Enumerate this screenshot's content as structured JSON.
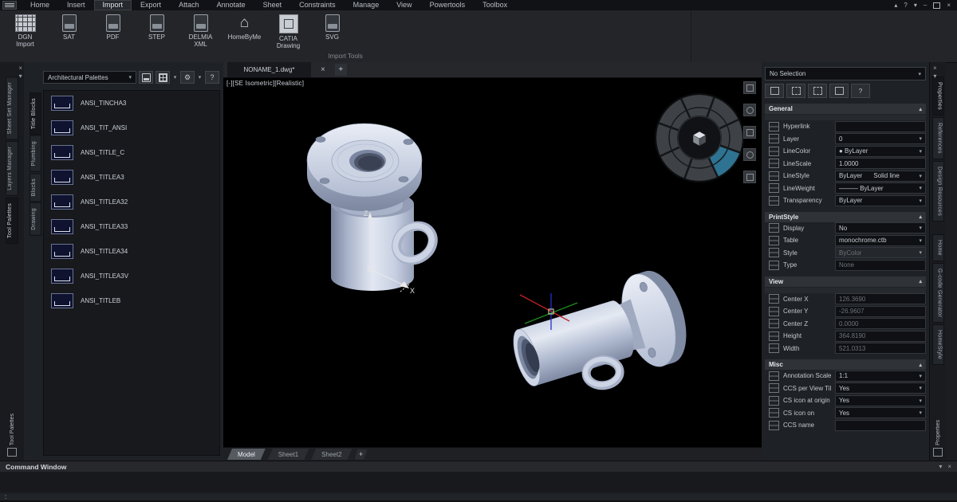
{
  "glyphs": {
    "dropdown": "▾",
    "collapse": "▴",
    "expand": "▴",
    "close": "×",
    "minimize": "–",
    "help": "?",
    "house": "⌂",
    "gear": "⚙",
    "prompt": ":"
  },
  "menubar": {
    "items": [
      "Home",
      "Insert",
      "Import",
      "Export",
      "Attach",
      "Annotate",
      "Sheet",
      "Constraints",
      "Manage",
      "View",
      "Powertools",
      "Toolbox"
    ],
    "active": "Import"
  },
  "ribbon": {
    "group_label": "Import Tools",
    "tools": [
      {
        "label": "DGN\nImport"
      },
      {
        "label": "SAT"
      },
      {
        "label": "PDF"
      },
      {
        "label": "STEP"
      },
      {
        "label": "DELMIA\nXML"
      },
      {
        "label": "HomeByMe"
      },
      {
        "label": "CATIA\nDrawing"
      },
      {
        "label": "SVG"
      }
    ]
  },
  "left_rail": {
    "tabs": [
      "Sheet Set Manager",
      "Layers Manager",
      "Tool Palettes"
    ],
    "active": "Tool Palettes",
    "bottom_label": "Tool Palettes"
  },
  "right_rail": {
    "tabs": [
      "Properties",
      "References",
      "Design Resources",
      "Home",
      "G-code Generator",
      "HomeStyle"
    ],
    "active": "Properties",
    "bottom_label": "Properties"
  },
  "palette": {
    "dropdown": "Architectural Palettes",
    "tabs": [
      "Title Blocks",
      "Plumbing",
      "Blocks",
      "Drawing"
    ],
    "items": [
      "ANSI_TINCHA3",
      "ANSI_TIT_ANSI",
      "ANSI_TITLE_C",
      "ANSI_TITLEA3",
      "ANSI_TITLEA32",
      "ANSI_TITLEA33",
      "ANSI_TITLEA34",
      "ANSI_TITLEA3V",
      "ANSI_TITLEB"
    ]
  },
  "document": {
    "tab": "NONAME_1.dwg*",
    "new_tab": "+"
  },
  "viewport": {
    "view_control": "[-][SE Isometric][Realistic]",
    "ucs_z": "Z",
    "ucs_x": "X"
  },
  "sheet_tabs": {
    "items": [
      "Model",
      "Sheet1",
      "Sheet2"
    ],
    "active": "Model",
    "add": "+"
  },
  "properties": {
    "selector": "No Selection",
    "sections": [
      {
        "title": "General",
        "rows": [
          {
            "label": "Hyperlink",
            "value": ""
          },
          {
            "label": "Layer",
            "value": "0"
          },
          {
            "label": "LineColor",
            "value": "● ByLayer"
          },
          {
            "label": "LineScale",
            "value": "1.0000"
          },
          {
            "label": "LineStyle",
            "value": "ByLayer",
            "value2": "Solid line"
          },
          {
            "label": "LineWeight",
            "value": "——— ByLayer"
          },
          {
            "label": "Transparency",
            "value": "ByLayer"
          }
        ]
      },
      {
        "title": "PrintStyle",
        "rows": [
          {
            "label": "Display",
            "value": "No"
          },
          {
            "label": "Table",
            "value": "monochrome.ctb"
          },
          {
            "label": "Style",
            "value": "ByColor"
          },
          {
            "label": "Type",
            "value": "None"
          }
        ]
      },
      {
        "title": "View",
        "rows": [
          {
            "label": "Center X",
            "value": "126.3690"
          },
          {
            "label": "Center Y",
            "value": "-26.9607"
          },
          {
            "label": "Center Z",
            "value": "0.0000"
          },
          {
            "label": "Height",
            "value": "364.8190"
          },
          {
            "label": "Width",
            "value": "521.0313"
          }
        ]
      },
      {
        "title": "Misc",
        "rows": [
          {
            "label": "Annotation Scale",
            "value": "1:1"
          },
          {
            "label": "CCS per View Tile",
            "value": "Yes"
          },
          {
            "label": "CS icon at origin",
            "value": "Yes"
          },
          {
            "label": "CS icon on",
            "value": "Yes"
          },
          {
            "label": "CCS name",
            "value": ""
          }
        ]
      }
    ]
  },
  "command_window": {
    "title": "Command Window",
    "prompt": ":"
  },
  "colors": {
    "accent_teal": "#2e7391",
    "model_steel": "#b6c0d6",
    "viewport_bg": "#000000"
  }
}
